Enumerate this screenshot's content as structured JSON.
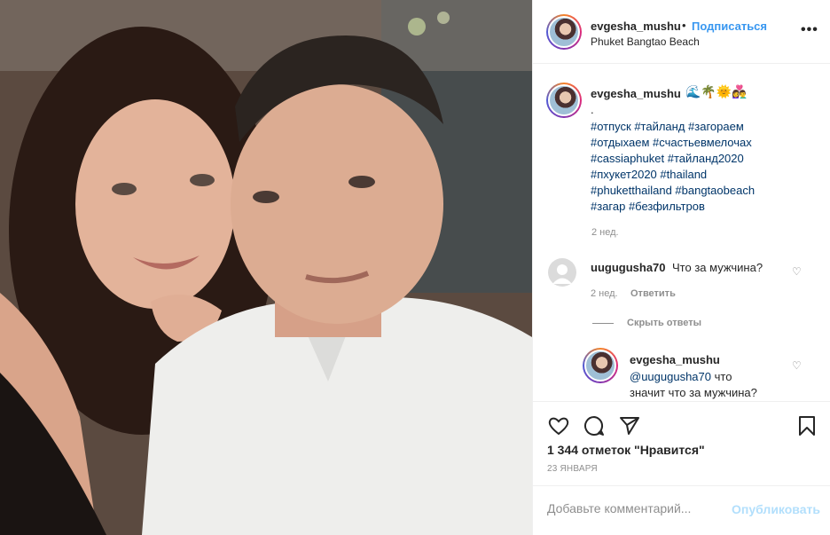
{
  "post": {
    "author": "evgesha_mushu",
    "follow_separator": "•",
    "follow_label": "Подписаться",
    "location": "Phuket Bangtao Beach",
    "more_label": "•••",
    "photo_alt": "Couple selfie"
  },
  "caption": {
    "author": "evgesha_mushu",
    "emojis": "🌊🌴🌞👩‍❤️‍👨",
    "dot": ".",
    "hashtag_lines": [
      "#отпуск #тайланд #загораем",
      "#отдыхаем #счастьевмелочах",
      "#cassiaphuket #тайланд2020",
      "#пхукет2020 #thailand",
      "#phuketthailand #bangtaobeach",
      "#загар #безфильтров"
    ],
    "time": "2 нед."
  },
  "comment": {
    "author": "uugugusha70",
    "text": "Что за мужчина?",
    "time": "2 нед.",
    "reply_label": "Ответить",
    "hide_replies_label": "Скрыть ответы"
  },
  "reply": {
    "author": "evgesha_mushu",
    "mention": "@uugugusha70",
    "text_line1": " что",
    "text_line2": "значит что за мужчина?"
  },
  "actions": {
    "likes": "1 344 отметок \"Нравится\"",
    "date": "23 ЯНВАРЯ",
    "comment_placeholder": "Добавьте комментарий...",
    "publish_label": "Опубликовать"
  },
  "colors": {
    "link": "#3897f0",
    "hashtag": "#003569",
    "muted": "#8e8e8e",
    "publish_disabled": "#b2dffc"
  }
}
